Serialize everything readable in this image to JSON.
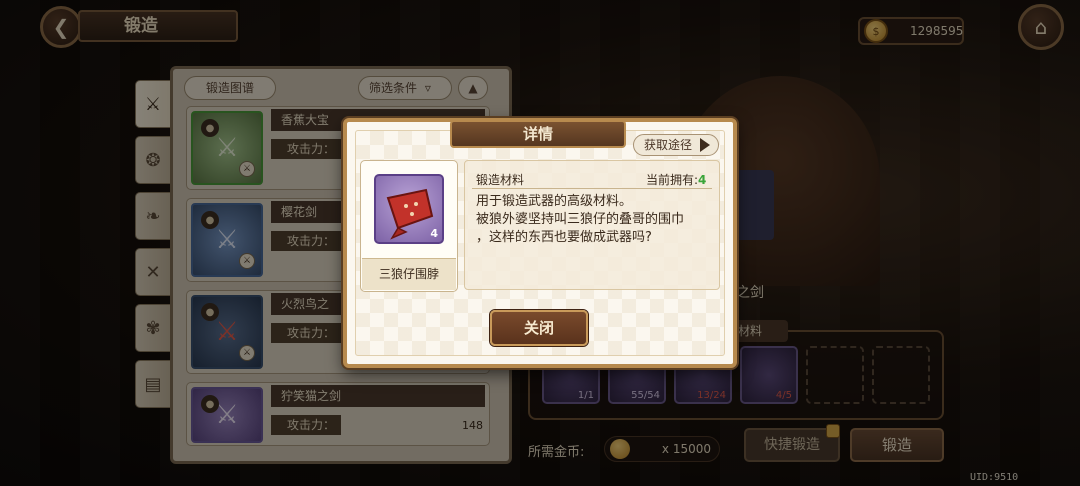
{
  "header": {
    "title": "锻造",
    "coins": "1298595"
  },
  "list": {
    "recipe_button": "锻造图谱",
    "filter_button": "筛选条件",
    "items": [
      {
        "name": "香蕉大宝",
        "atk_label": "攻击力：",
        "atk_value": ""
      },
      {
        "name": "樱花剑",
        "atk_label": "攻击力：",
        "atk_value": ""
      },
      {
        "name": "火烈鸟之",
        "atk_label": "攻击力：",
        "atk_value": ""
      },
      {
        "name": "狞笑猫之剑",
        "atk_label": "攻击力：",
        "atk_value": "148"
      }
    ]
  },
  "forge": {
    "weapon_name_fragment": "之剑",
    "materials_tab": "材料",
    "slots": [
      {
        "count": "1/1",
        "red": false
      },
      {
        "count": "55/54",
        "red": false
      },
      {
        "count": "13/24",
        "red": true
      },
      {
        "count": "4/5",
        "red": true
      }
    ],
    "gold_label": "所需金币:",
    "gold_value": "x 15000",
    "quick_forge": "快捷锻造",
    "forge": "锻造"
  },
  "uid": "UID:9510",
  "modal": {
    "title": "详情",
    "source_button": "获取途径",
    "item_name": "三狼仔围脖",
    "item_count": "4",
    "section_title": "锻造材料",
    "owned_label": "当前拥有:",
    "owned_value": "4",
    "description": "用于锻造武器的高级材料。\n被狼外婆坚持叫三狼仔的叠哥的围巾\n，这样的东西也要做成武器吗?",
    "close_button": "关闭"
  },
  "colors": {
    "accent_gold": "#b78a4e",
    "owned_green": "#3aa53a",
    "insufficient_red": "#e05a4a"
  }
}
